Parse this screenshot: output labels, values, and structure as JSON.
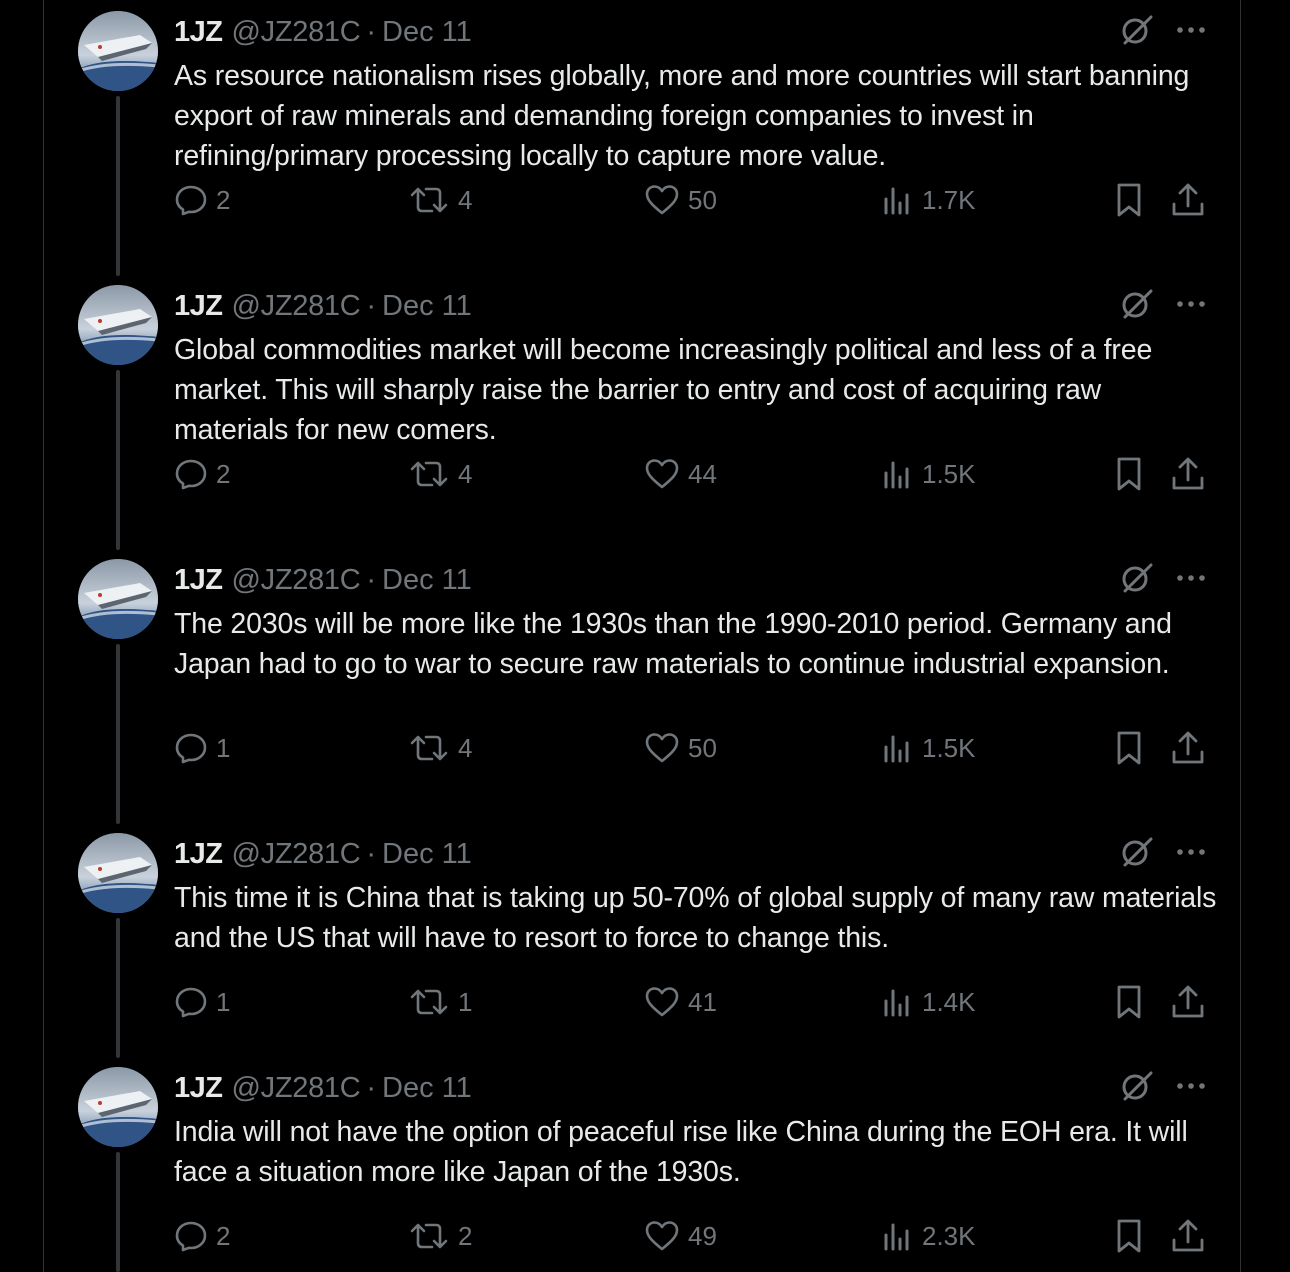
{
  "colors": {
    "background": "#000000",
    "text_primary": "#e7e9ea",
    "text_secondary": "#71767b",
    "border": "#2f3336",
    "thread_line": "#333639"
  },
  "tweets": [
    {
      "name": "1JZ",
      "handle": "@JZ281C",
      "separator": "·",
      "date": "Dec 11",
      "text": "As resource nationalism rises globally, more and more countries will start banning export of raw minerals and demanding foreign companies to invest in refining/primary processing locally to capture more value.",
      "replies": "2",
      "retweets": "4",
      "likes": "50",
      "views": "1.7K"
    },
    {
      "name": "1JZ",
      "handle": "@JZ281C",
      "separator": "·",
      "date": "Dec 11",
      "text": "Global commodities market will become increasingly political and less of a free market. This will sharply raise the barrier to entry and cost of acquiring raw materials for new comers.",
      "replies": "2",
      "retweets": "4",
      "likes": "44",
      "views": "1.5K"
    },
    {
      "name": "1JZ",
      "handle": "@JZ281C",
      "separator": "·",
      "date": "Dec 11",
      "text": "The 2030s will be more like the 1930s than the 1990-2010 period. Germany and Japan had to go to war to secure raw materials to continue industrial expansion.",
      "replies": "1",
      "retweets": "4",
      "likes": "50",
      "views": "1.5K"
    },
    {
      "name": "1JZ",
      "handle": "@JZ281C",
      "separator": "·",
      "date": "Dec 11",
      "text": "This time it is China that is taking up 50-70% of global supply of many raw materials and the US that will have to resort to force to change this.",
      "replies": "1",
      "retweets": "1",
      "likes": "41",
      "views": "1.4K"
    },
    {
      "name": "1JZ",
      "handle": "@JZ281C",
      "separator": "·",
      "date": "Dec 11",
      "text": "India will not have the option of peaceful rise like China during the EOH era. It will face a situation more like Japan of the 1930s.",
      "replies": "2",
      "retweets": "2",
      "likes": "49",
      "views": "2.3K"
    }
  ]
}
